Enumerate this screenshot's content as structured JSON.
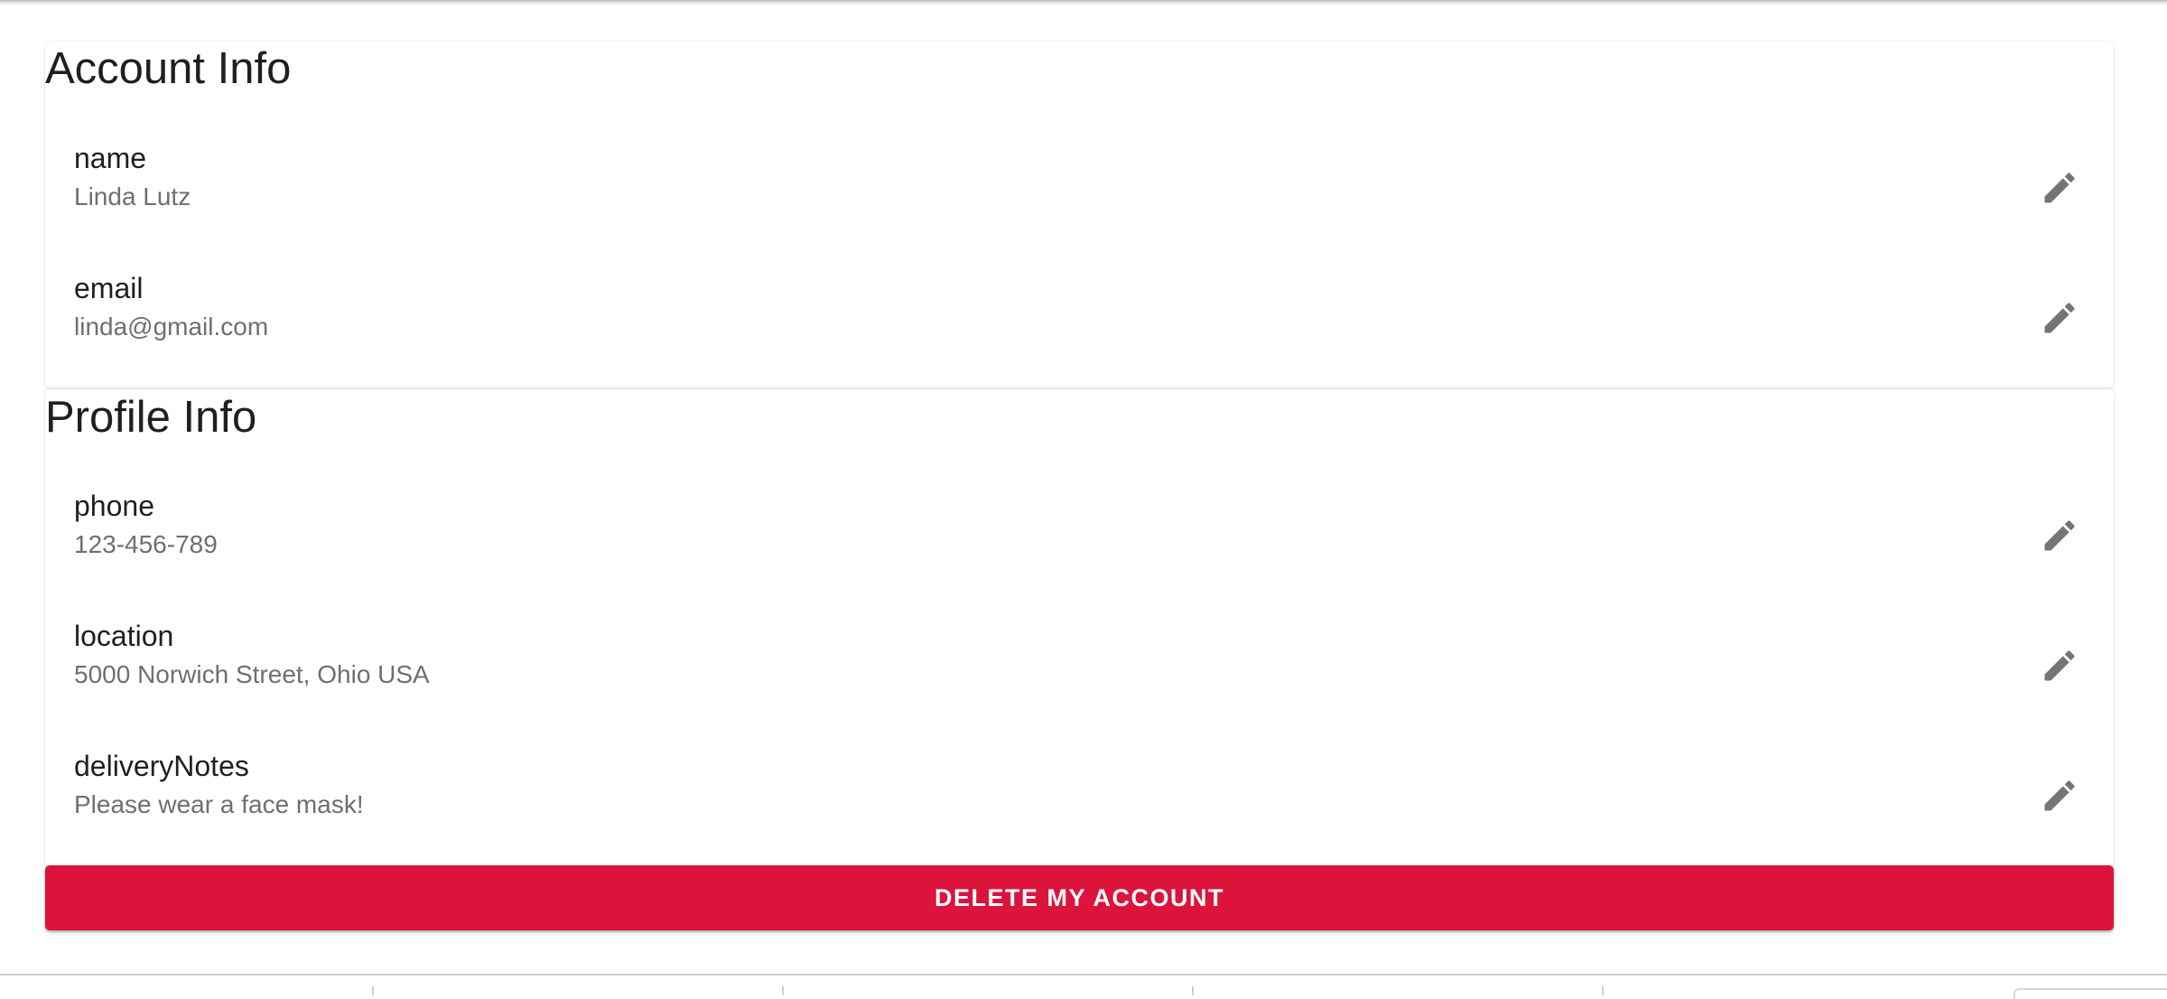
{
  "account_info": {
    "title": "Account Info",
    "fields": [
      {
        "label": "name",
        "value": "Linda Lutz"
      },
      {
        "label": "email",
        "value": "linda@gmail.com"
      }
    ]
  },
  "profile_info": {
    "title": "Profile Info",
    "fields": [
      {
        "label": "phone",
        "value": "123-456-789"
      },
      {
        "label": "location",
        "value": "5000 Norwich Street, Ohio USA"
      },
      {
        "label": "deliveryNotes",
        "value": "Please wear a face mask!"
      }
    ]
  },
  "actions": {
    "delete_label": "DELETE MY ACCOUNT"
  },
  "icons": {
    "edit": "pencil-icon"
  },
  "colors": {
    "danger": "#dc143c",
    "icon": "#757575",
    "label_text": "#1f1f1f",
    "value_text": "#6f6f6f"
  }
}
